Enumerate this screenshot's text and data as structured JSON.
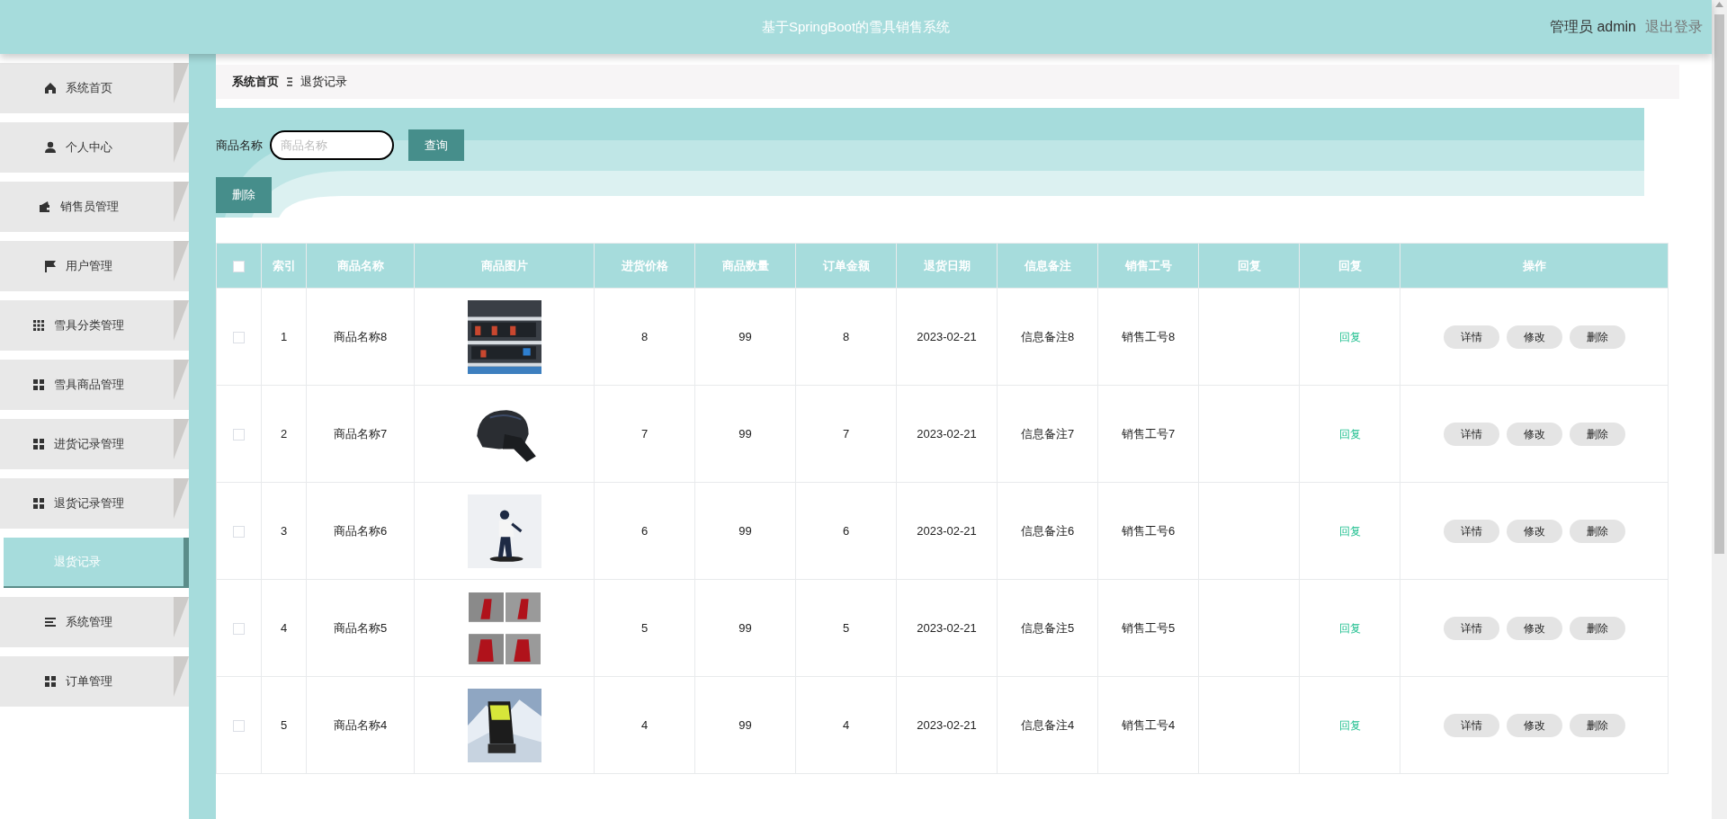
{
  "header": {
    "title": "基于SpringBoot的雪具销售系统",
    "user": "管理员 admin",
    "logout": "退出登录"
  },
  "sidebar": {
    "items": [
      {
        "label": "系统首页",
        "selected": false
      },
      {
        "label": "个人中心",
        "selected": false
      },
      {
        "label": "销售员管理",
        "selected": false
      },
      {
        "label": "用户管理",
        "selected": false
      },
      {
        "label": "雪具分类管理",
        "selected": false
      },
      {
        "label": "雪具商品管理",
        "selected": false
      },
      {
        "label": "进货记录管理",
        "selected": false
      },
      {
        "label": "退货记录管理",
        "selected": false,
        "children": [
          {
            "label": "退货记录",
            "selected": true
          }
        ]
      },
      {
        "label": "系统管理",
        "selected": false
      },
      {
        "label": "订单管理",
        "selected": false
      }
    ]
  },
  "breadcrumb": [
    "系统首页",
    "退货记录"
  ],
  "search": {
    "label": "商品名称",
    "placeholder": "商品名称",
    "button": "查询"
  },
  "delete_button": "删除",
  "table": {
    "select_all": {
      "checked": false
    },
    "columns": [
      "索引",
      "商品名称",
      "商品图片",
      "进货价格",
      "商品数量",
      "订单金额",
      "退货日期",
      "信息备注",
      "销售工号",
      "回复",
      "回复",
      "操作"
    ],
    "rows": [
      {
        "checked": false,
        "index": "1",
        "name": "商品名称8",
        "price": "8",
        "quantity": "99",
        "amount": "8",
        "date": "2023-02-21",
        "note": "信息备注8",
        "staff_no": "销售工号8",
        "reply_link": "回复",
        "actions": [
          "详情",
          "修改",
          "删除"
        ]
      },
      {
        "checked": false,
        "index": "2",
        "name": "商品名称7",
        "price": "7",
        "quantity": "99",
        "amount": "7",
        "date": "2023-02-21",
        "note": "信息备注7",
        "staff_no": "销售工号7",
        "reply_link": "回复",
        "actions": [
          "详情",
          "修改",
          "删除"
        ]
      },
      {
        "checked": false,
        "index": "3",
        "name": "商品名称6",
        "price": "6",
        "quantity": "99",
        "amount": "6",
        "date": "2023-02-21",
        "note": "信息备注6",
        "staff_no": "销售工号6",
        "reply_link": "回复",
        "actions": [
          "详情",
          "修改",
          "删除"
        ]
      },
      {
        "checked": false,
        "index": "4",
        "name": "商品名称5",
        "price": "5",
        "quantity": "99",
        "amount": "5",
        "date": "2023-02-21",
        "note": "信息备注5",
        "staff_no": "销售工号5",
        "reply_link": "回复",
        "actions": [
          "详情",
          "修改",
          "删除"
        ]
      },
      {
        "checked": false,
        "index": "5",
        "name": "商品名称4",
        "price": "4",
        "quantity": "99",
        "amount": "4",
        "date": "2023-02-21",
        "note": "信息备注4",
        "staff_no": "销售工号4",
        "reply_link": "回复",
        "actions": [
          "详情",
          "修改",
          "删除"
        ]
      }
    ]
  }
}
